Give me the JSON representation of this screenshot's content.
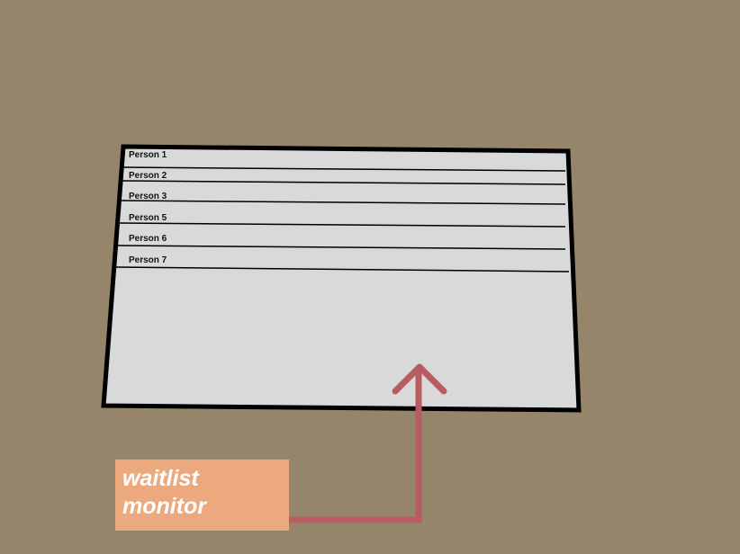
{
  "monitor": {
    "rows": [
      {
        "label": "Person 1"
      },
      {
        "label": "Person 2"
      },
      {
        "label": "Person 3"
      },
      {
        "label": "Person 5"
      },
      {
        "label": "Person 6"
      },
      {
        "label": "Person 7"
      }
    ]
  },
  "callout": {
    "label": "waitlist\nmonitor"
  },
  "colors": {
    "background": "#95866b",
    "screen_fill": "#d9d9d9",
    "screen_border": "#000000",
    "arrow": "#b85c63",
    "callout_fill": "#eda97e",
    "callout_text": "#ffffff"
  }
}
